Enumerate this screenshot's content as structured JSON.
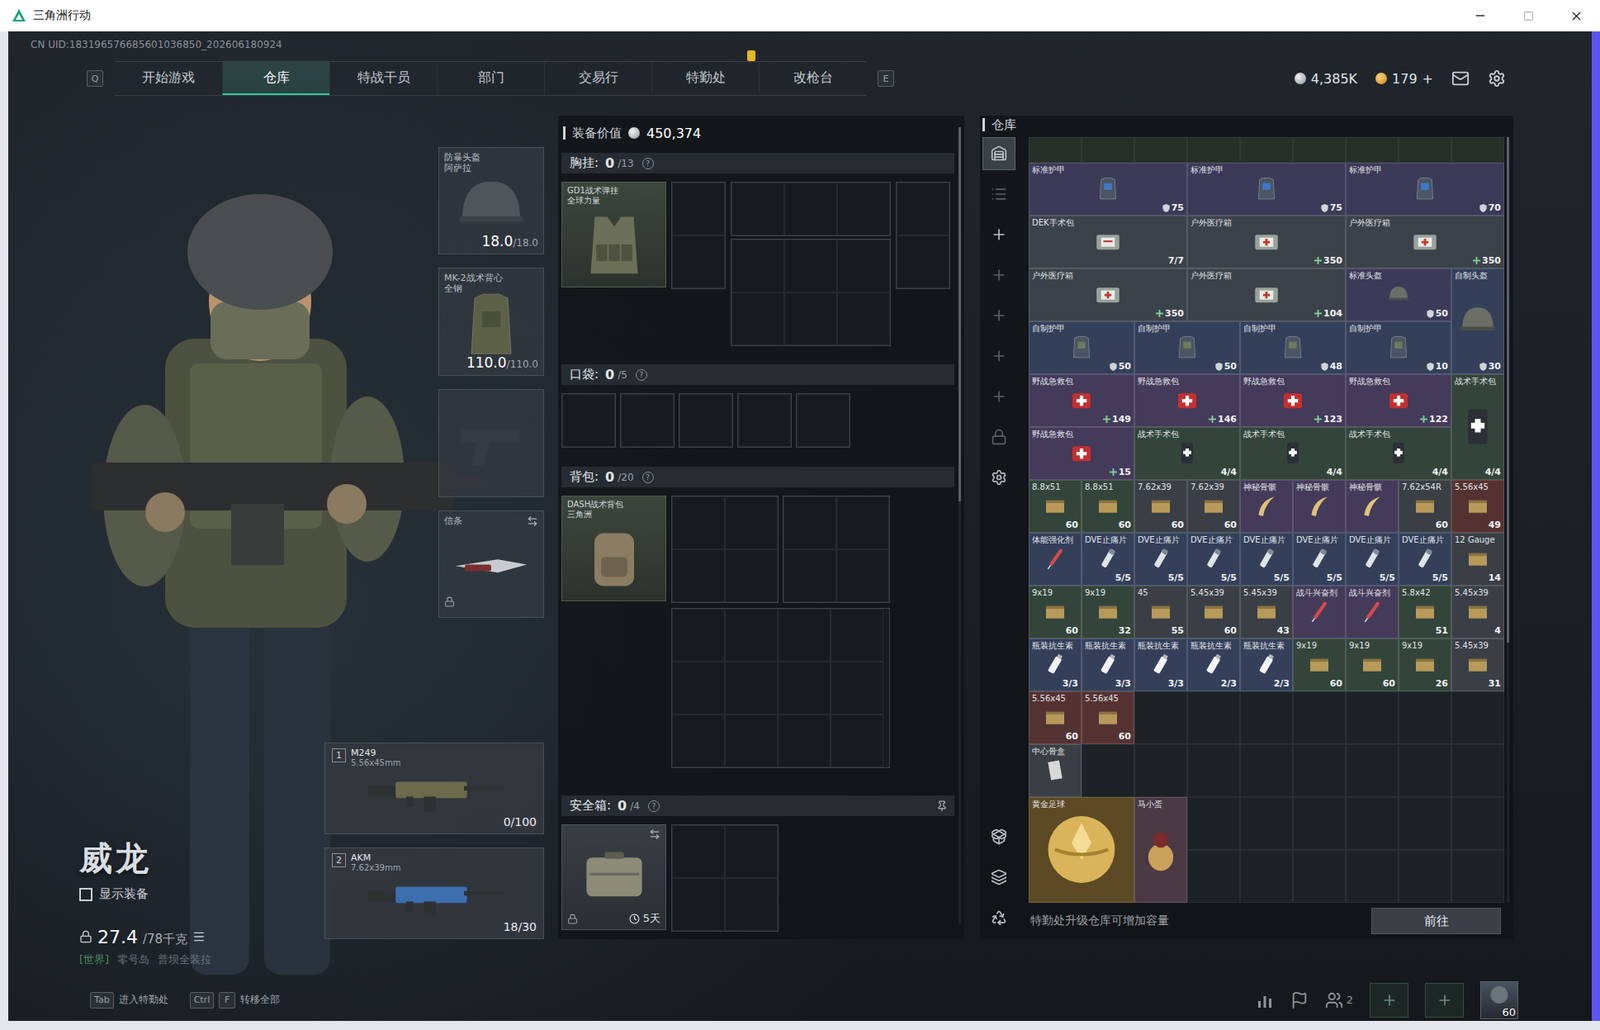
{
  "window": {
    "title": "三角洲行动"
  },
  "uid": "CN UID:183196576685601036850_202606180924",
  "nav": {
    "prev_key": "Q",
    "next_key": "E",
    "tabs": [
      {
        "label": "开始游戏",
        "selected": false,
        "alert": false
      },
      {
        "label": "仓库",
        "selected": true,
        "alert": false
      },
      {
        "label": "特战干员",
        "selected": false,
        "alert": false
      },
      {
        "label": "部门",
        "selected": false,
        "alert": false
      },
      {
        "label": "交易行",
        "selected": false,
        "alert": false
      },
      {
        "label": "特勤处",
        "selected": false,
        "alert": true
      },
      {
        "label": "改枪台",
        "selected": false,
        "alert": false
      }
    ]
  },
  "currency": [
    {
      "kind": "silver",
      "value": "4,385K",
      "add": ""
    },
    {
      "kind": "gold",
      "value": "179",
      "add": "+"
    }
  ],
  "character": {
    "name": "威龙",
    "show_gear": {
      "label": "显示装备",
      "checked": false
    },
    "weight": "27.4",
    "capacity": "/78千克",
    "location": {
      "channel": "[世界]",
      "map": "零号岛",
      "mode": "普坝全装拉"
    }
  },
  "slots": [
    {
      "kind": "helmet",
      "name": "防暴头盔",
      "sub": "阿萨拉",
      "reading": "18.0",
      "max": "/18.0",
      "locked": false,
      "empty": false
    },
    {
      "kind": "armor",
      "name": "MK-2战术背心",
      "sub": "全钢",
      "reading": "110.0",
      "max": "/110.0",
      "locked": false,
      "empty": false
    },
    {
      "kind": "pistol",
      "name": "",
      "sub": "",
      "reading": "",
      "max": "",
      "locked": false,
      "empty": true
    },
    {
      "kind": "melee",
      "name": "信条",
      "sub": "",
      "reading": "",
      "max": "",
      "locked": true,
      "empty": false
    }
  ],
  "weapons": [
    {
      "index": "1",
      "name": "M249",
      "caliber": "5.56x45mm",
      "ammo": "0/100",
      "color": "#6b6a4a"
    },
    {
      "index": "2",
      "name": "AKM",
      "caliber": "7.62x39mm",
      "ammo": "18/30",
      "color": "#3d6fb0"
    }
  ],
  "loadout": {
    "value_label": "装备价值",
    "value": "450,374",
    "scroll": 0.47,
    "chest": {
      "label": "胸挂:",
      "used": "0",
      "capacity": "/13",
      "help": "?",
      "item": {
        "name": "GD1战术弹挂",
        "sub": "全球力量"
      }
    },
    "pocket": {
      "label": "口袋:",
      "used": "0",
      "capacity": "/5",
      "help": "?"
    },
    "backpack": {
      "label": "背包:",
      "used": "0",
      "capacity": "/20",
      "help": "?",
      "item": {
        "name": "DASH战术背包",
        "sub": "三角洲"
      }
    },
    "safe": {
      "label": "安全箱:",
      "used": "0",
      "capacity": "/4",
      "help": "?",
      "timer": "5天",
      "locked": true
    }
  },
  "warehouse": {
    "title": "仓库",
    "scroll": 0.66,
    "footer": "特勤处升级仓库可增加容量",
    "button": "前往",
    "rail_top": [
      {
        "kind": "storage",
        "selected": true,
        "disabled": false
      },
      {
        "kind": "list",
        "selected": false,
        "disabled": true
      },
      {
        "kind": "add",
        "selected": false,
        "disabled": false
      },
      {
        "kind": "add",
        "selected": false,
        "disabled": true
      },
      {
        "kind": "add",
        "selected": false,
        "disabled": true
      },
      {
        "kind": "add",
        "selected": false,
        "disabled": true
      },
      {
        "kind": "add",
        "selected": false,
        "disabled": true
      },
      {
        "kind": "lock",
        "selected": false,
        "disabled": true
      },
      {
        "kind": "settings",
        "selected": false,
        "disabled": false
      }
    ],
    "rail_bottom": [
      {
        "kind": "transfer",
        "selected": false,
        "disabled": false
      },
      {
        "kind": "layers",
        "selected": false,
        "disabled": false
      },
      {
        "kind": "recycle",
        "selected": false,
        "disabled": false
      }
    ],
    "items": [
      {
        "name": "标准护甲",
        "kind": "armor",
        "count": "75",
        "col": 1,
        "row": 1,
        "color": "#3b3a58"
      },
      {
        "name": "标准护甲",
        "kind": "armor",
        "count": "75",
        "col": 4,
        "row": 1,
        "color": "#3b3a58"
      },
      {
        "name": "标准护甲",
        "kind": "armor",
        "count": "70",
        "col": 7,
        "row": 1,
        "color": "#3b3a58"
      },
      {
        "name": "DEK手术包",
        "kind": "kit",
        "count": "7/7",
        "col": 1,
        "row": 2,
        "color": "#3c424a"
      },
      {
        "name": "户外医疗箱",
        "kind": "medbox",
        "count": "350",
        "col": 4,
        "row": 2,
        "color": "#3c424a"
      },
      {
        "name": "户外医疗箱",
        "kind": "medbox",
        "count": "350",
        "col": 7,
        "row": 2,
        "color": "#3c424a"
      },
      {
        "name": "户外医疗箱",
        "kind": "medbox",
        "count": "350",
        "col": 1,
        "row": 3,
        "color": "#3c424a"
      },
      {
        "name": "户外医疗箱",
        "kind": "medbox",
        "count": "104",
        "col": 4,
        "row": 3,
        "color": "#3c424a"
      },
      {
        "name": "标准头盔",
        "kind": "helmet",
        "count": "50",
        "col": 7,
        "row": 3,
        "color": "#3b3a58"
      },
      {
        "name": "自制头盔",
        "kind": "helmet-tall",
        "count": "30",
        "col": 9,
        "row": 3,
        "color": "#34405a"
      },
      {
        "name": "自制护甲",
        "kind": "vest",
        "count": "50",
        "col": 1,
        "row": 4,
        "color": "#34405a"
      },
      {
        "name": "自制护甲",
        "kind": "vest",
        "count": "50",
        "col": 3,
        "row": 4,
        "color": "#34405a"
      },
      {
        "name": "自制护甲",
        "kind": "vest",
        "count": "48",
        "col": 5,
        "row": 4,
        "color": "#34405a"
      },
      {
        "name": "自制护甲",
        "kind": "vest",
        "count": "10",
        "col": 7,
        "row": 4,
        "color": "#34405a"
      },
      {
        "name": "野战急救包",
        "kind": "firstaid",
        "count": "149",
        "col": 1,
        "row": 5,
        "color": "#443a5a"
      },
      {
        "name": "野战急救包",
        "kind": "firstaid",
        "count": "146",
        "col": 3,
        "row": 5,
        "color": "#443a5a"
      },
      {
        "name": "野战急救包",
        "kind": "firstaid",
        "count": "123",
        "col": 5,
        "row": 5,
        "color": "#443a5a"
      },
      {
        "name": "野战急救包",
        "kind": "firstaid",
        "count": "122",
        "col": 7,
        "row": 5,
        "color": "#443a5a"
      },
      {
        "name": "战术手术包",
        "kind": "surgery-tall",
        "count": "4/4",
        "col": 9,
        "row": 5,
        "color": "#33453a"
      },
      {
        "name": "野战急救包",
        "kind": "firstaid",
        "count": "15",
        "col": 1,
        "row": 6,
        "color": "#443a5a"
      },
      {
        "name": "战术手术包",
        "kind": "surgery",
        "count": "4/4",
        "col": 3,
        "row": 6,
        "color": "#33453a"
      },
      {
        "name": "战术手术包",
        "kind": "surgery",
        "count": "4/4",
        "col": 5,
        "row": 6,
        "color": "#33453a"
      },
      {
        "name": "战术手术包",
        "kind": "surgery",
        "count": "4/4",
        "col": 7,
        "row": 6,
        "color": "#33453a"
      },
      {
        "name": "8.8x51",
        "kind": "ammo",
        "count": "60",
        "col": 1,
        "row": 7,
        "color": "#33453a"
      },
      {
        "name": "8.8x51",
        "kind": "ammo",
        "count": "60",
        "col": 2,
        "row": 7,
        "color": "#33453a"
      },
      {
        "name": "7.62x39",
        "kind": "ammo",
        "count": "60",
        "col": 3,
        "row": 7,
        "color": "#3a3f46"
      },
      {
        "name": "7.62x39",
        "kind": "ammo",
        "count": "60",
        "col": 4,
        "row": 7,
        "color": "#3a3f46"
      },
      {
        "name": "神秘骨骸",
        "kind": "relic",
        "count": "",
        "col": 5,
        "row": 7,
        "color": "#443a5a"
      },
      {
        "name": "神秘骨骸",
        "kind": "relic",
        "count": "",
        "col": 6,
        "row": 7,
        "color": "#443a5a"
      },
      {
        "name": "神秘骨骸",
        "kind": "relic",
        "count": "",
        "col": 7,
        "row": 7,
        "color": "#443a5a"
      },
      {
        "name": "7.62x54R",
        "kind": "ammo",
        "count": "60",
        "col": 8,
        "row": 7,
        "color": "#3a3f46"
      },
      {
        "name": "5.56x45",
        "kind": "ammo",
        "count": "49",
        "col": 9,
        "row": 7,
        "color": "#553232"
      },
      {
        "name": "体能强化剂",
        "kind": "syringe",
        "count": "",
        "col": 1,
        "row": 8,
        "color": "#34405a"
      },
      {
        "name": "DVE止痛片",
        "kind": "pill",
        "count": "5/5",
        "col": 2,
        "row": 8,
        "color": "#34405a"
      },
      {
        "name": "DVE止痛片",
        "kind": "pill",
        "count": "5/5",
        "col": 3,
        "row": 8,
        "color": "#34405a"
      },
      {
        "name": "DVE止痛片",
        "kind": "pill",
        "count": "5/5",
        "col": 4,
        "row": 8,
        "color": "#34405a"
      },
      {
        "name": "DVE止痛片",
        "kind": "pill",
        "count": "5/5",
        "col": 5,
        "row": 8,
        "color": "#34405a"
      },
      {
        "name": "DVE止痛片",
        "kind": "pill",
        "count": "5/5",
        "col": 6,
        "row": 8,
        "color": "#34405a"
      },
      {
        "name": "DVE止痛片",
        "kind": "pill",
        "count": "5/5",
        "col": 7,
        "row": 8,
        "color": "#34405a"
      },
      {
        "name": "DVE止痛片",
        "kind": "pill",
        "count": "5/5",
        "col": 8,
        "row": 8,
        "color": "#34405a"
      },
      {
        "name": "12 Gauge",
        "kind": "ammo",
        "count": "14",
        "col": 9,
        "row": 8,
        "color": "#3a3f46"
      },
      {
        "name": "9x19",
        "kind": "ammo",
        "count": "60",
        "col": 1,
        "row": 9,
        "color": "#33453a"
      },
      {
        "name": "9x19",
        "kind": "ammo",
        "count": "32",
        "col": 2,
        "row": 9,
        "color": "#33453a"
      },
      {
        "name": "45",
        "kind": "ammo",
        "count": "55",
        "col": 3,
        "row": 9,
        "color": "#3a3f46"
      },
      {
        "name": "5.45x39",
        "kind": "ammo",
        "count": "60",
        "col": 4,
        "row": 9,
        "color": "#3a3f46"
      },
      {
        "name": "5.45x39",
        "kind": "ammo",
        "count": "43",
        "col": 5,
        "row": 9,
        "color": "#3a3f46"
      },
      {
        "name": "战斗兴奋剂",
        "kind": "syringe",
        "count": "",
        "col": 6,
        "row": 9,
        "color": "#443a5a"
      },
      {
        "name": "战斗兴奋剂",
        "kind": "syringe",
        "count": "",
        "col": 7,
        "row": 9,
        "color": "#443a5a"
      },
      {
        "name": "5.8x42",
        "kind": "ammo",
        "count": "51",
        "col": 8,
        "row": 9,
        "color": "#33453a"
      },
      {
        "name": "5.45x39",
        "kind": "ammo",
        "count": "4",
        "col": 9,
        "row": 9,
        "color": "#3a3f46"
      },
      {
        "name": "瓶装抗生素",
        "kind": "antibiotic",
        "count": "3/3",
        "col": 1,
        "row": 10,
        "color": "#34405a"
      },
      {
        "name": "瓶装抗生素",
        "kind": "antibiotic",
        "count": "3/3",
        "col": 2,
        "row": 10,
        "color": "#34405a"
      },
      {
        "name": "瓶装抗生素",
        "kind": "antibiotic",
        "count": "3/3",
        "col": 3,
        "row": 10,
        "color": "#34405a"
      },
      {
        "name": "瓶装抗生素",
        "kind": "antibiotic",
        "count": "2/3",
        "col": 4,
        "row": 10,
        "color": "#34405a"
      },
      {
        "name": "瓶装抗生素",
        "kind": "antibiotic",
        "count": "2/3",
        "col": 5,
        "row": 10,
        "color": "#34405a"
      },
      {
        "name": "9x19",
        "kind": "ammo",
        "count": "60",
        "col": 6,
        "row": 10,
        "color": "#33453a"
      },
      {
        "name": "9x19",
        "kind": "ammo",
        "count": "60",
        "col": 7,
        "row": 10,
        "color": "#33453a"
      },
      {
        "name": "9x19",
        "kind": "ammo",
        "count": "26",
        "col": 8,
        "row": 10,
        "color": "#33453a"
      },
      {
        "name": "5.45x39",
        "kind": "ammo",
        "count": "31",
        "col": 9,
        "row": 10,
        "color": "#3a3f46"
      },
      {
        "name": "5.56x45",
        "kind": "ammo",
        "count": "60",
        "col": 1,
        "row": 11,
        "color": "#553232"
      },
      {
        "name": "5.56x45",
        "kind": "ammo",
        "count": "60",
        "col": 2,
        "row": 11,
        "color": "#553232"
      },
      {
        "name": "中心骨盒",
        "kind": "misc",
        "count": "",
        "col": 1,
        "row": 12,
        "color": "#3a3f46"
      },
      {
        "name": "黄金足球",
        "kind": "trophy",
        "count": "",
        "col": 1,
        "row": 13,
        "color": "#5c4a24"
      },
      {
        "name": "马小蛋",
        "kind": "figure",
        "count": "",
        "col": 3,
        "row": 13,
        "color": "#4a3a44"
      }
    ]
  },
  "bottom_bar": {
    "hints": [
      {
        "keys": [
          "Tab"
        ],
        "label": "进入特勤处"
      },
      {
        "keys": [
          "Ctrl",
          "F"
        ],
        "label": "转移全部"
      }
    ],
    "friends": "2",
    "level": "60"
  }
}
